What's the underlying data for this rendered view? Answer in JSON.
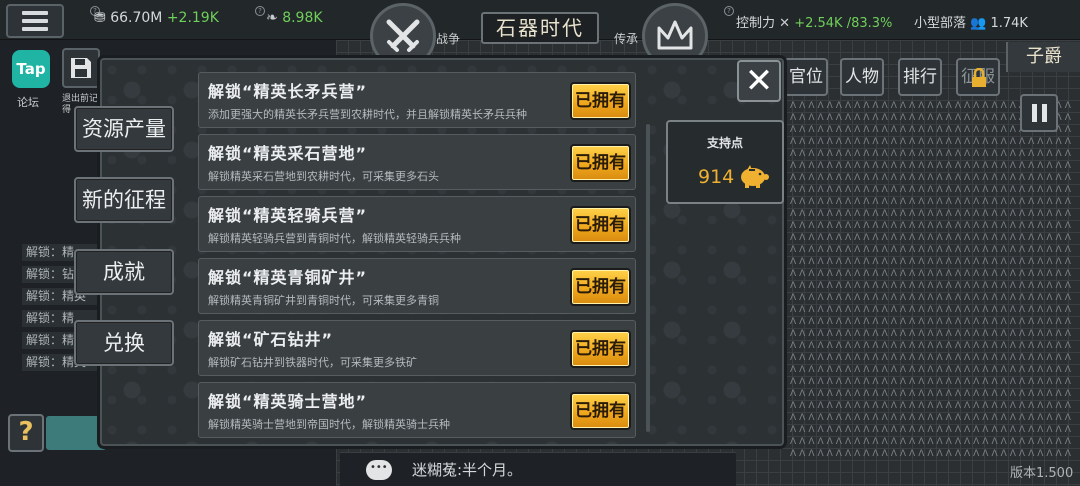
{
  "topbar": {
    "coins_value": "66.70M",
    "coins_delta": "+2.19K",
    "food_value": "8.98K",
    "battle_label": "战争",
    "era_title": "石器时代",
    "legacy_label": "传承",
    "control_label": "控制力",
    "control_delta": "+2.54K",
    "control_pct": "/83.3%",
    "tribe_label": "小型部落",
    "population": "1.74K"
  },
  "left_tools": {
    "tap_label": "Tap",
    "forum_label": "论坛",
    "save_label": "退出前记得"
  },
  "right_buttons": {
    "rank_title": "子爵",
    "office": "官位",
    "character": "人物",
    "ranking": "排行",
    "locked": "征服"
  },
  "side_nav": [
    {
      "label": "资源产量"
    },
    {
      "label": "新的征程"
    },
    {
      "label": "成就"
    },
    {
      "label": "兑换"
    }
  ],
  "log_lines": [
    "解锁：精",
    "解锁：钻",
    "解锁：精英",
    "解锁：精",
    "解锁：精",
    "解锁：精英"
  ],
  "items": [
    {
      "title": "解锁“精英长矛兵营”",
      "desc": "添加更强大的精英长矛兵营到农耕时代，并且解锁精英长矛兵兵种",
      "button": "已拥有"
    },
    {
      "title": "解锁“精英采石营地”",
      "desc": "解锁精英采石营地到农耕时代，可采集更多石头",
      "button": "已拥有"
    },
    {
      "title": "解锁“精英轻骑兵营”",
      "desc": "解锁精英轻骑兵营到青铜时代，解锁精英轻骑兵兵种",
      "button": "已拥有"
    },
    {
      "title": "解锁“精英青铜矿井”",
      "desc": "解锁精英青铜矿井到青铜时代，可采集更多青铜",
      "button": "已拥有"
    },
    {
      "title": "解锁“矿石钻井”",
      "desc": "解锁矿石钻井到铁器时代，可采集更多铁矿",
      "button": "已拥有"
    },
    {
      "title": "解锁“精英骑士营地”",
      "desc": "解锁精英骑士营地到帝国时代，解锁精英骑士兵种",
      "button": "已拥有"
    }
  ],
  "support": {
    "label": "支持点",
    "value": "914"
  },
  "chat": {
    "text": "迷糊菟:半个月。"
  },
  "version": "版本1.500",
  "close_label": "✕",
  "help_label": "?",
  "colors": {
    "owned_button": "#f0a81c",
    "delta_green": "#6fcf5a",
    "support_value": "#f0b030"
  }
}
